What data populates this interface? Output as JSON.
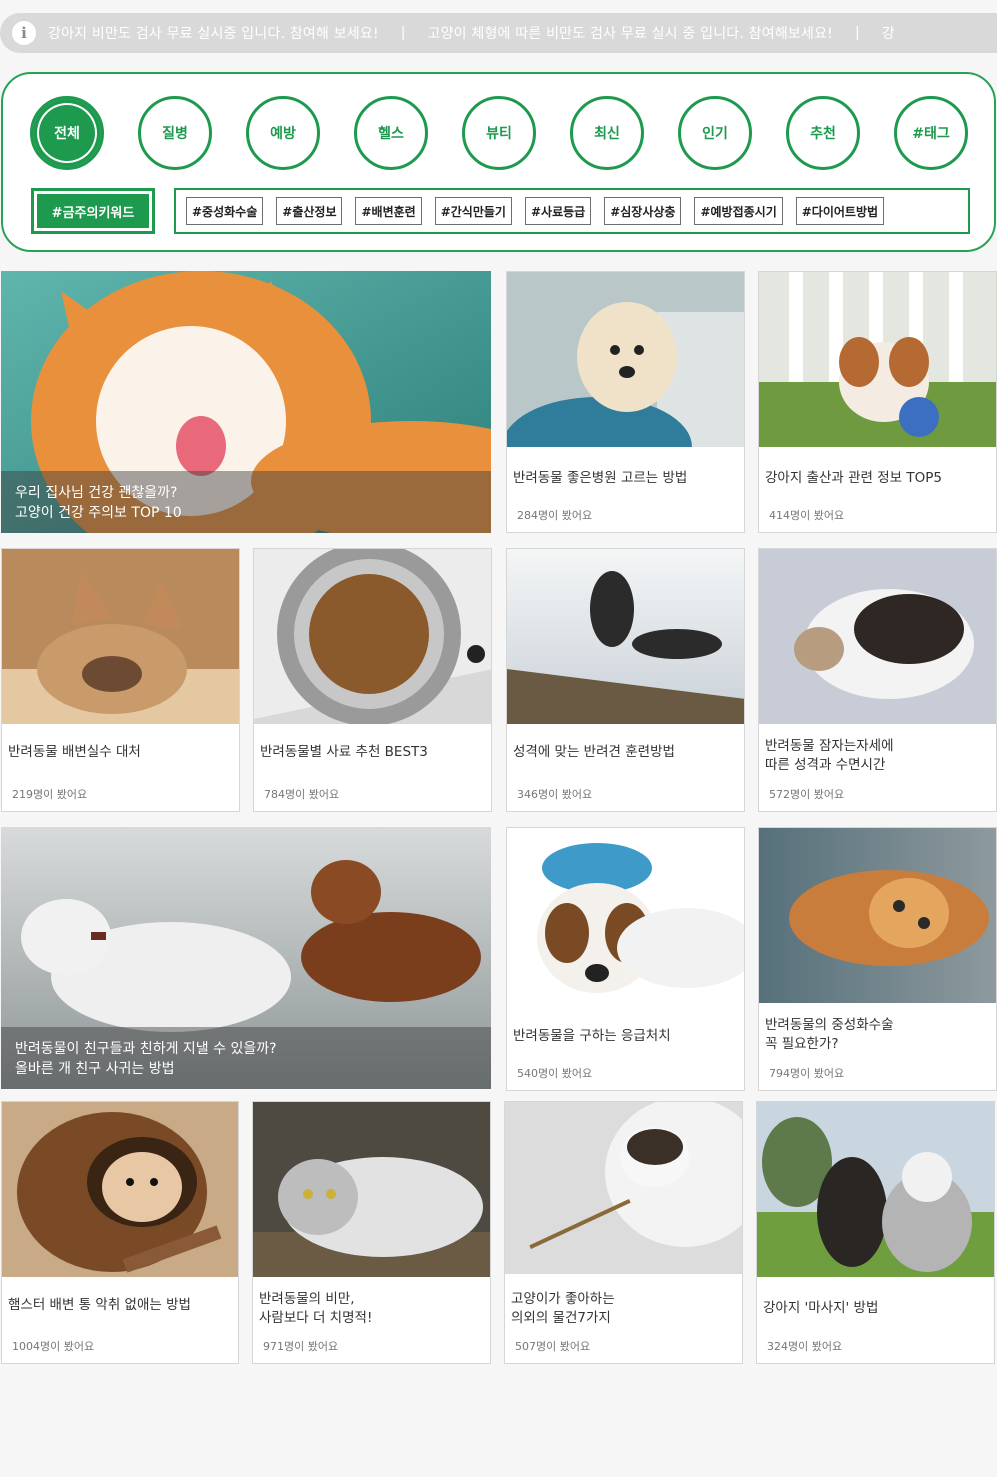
{
  "ticker": {
    "icon": "info-icon",
    "messages": [
      "강아지 비만도 검사 무료 실시중 입니다. 참여해 보세요!",
      "고양이 체형에 따른 비만도 검사 무료 실시 중 입니다.  참여해보세요!",
      "강"
    ],
    "separator": "|"
  },
  "categories": [
    {
      "label": "전체",
      "active": true
    },
    {
      "label": "질병"
    },
    {
      "label": "예방"
    },
    {
      "label": "헬스"
    },
    {
      "label": "뷰티"
    },
    {
      "label": "최신"
    },
    {
      "label": "인기"
    },
    {
      "label": "추천"
    },
    {
      "label": "#태그"
    }
  ],
  "warning_keyword_label": "#금주의키워드",
  "tags": [
    "#중성화수술",
    "#출산정보",
    "#배변훈련",
    "#간식만들기",
    "#사료등급",
    "#심장사상충",
    "#예방접종시기",
    "#다이어트방법"
  ],
  "cards": {
    "c1": {
      "title": "우리 집사님 건강 괜찮을까?\n  고양이 건강 주의보 TOP 10"
    },
    "c2": {
      "title": "반려동물 좋은병원 고르는 방법",
      "views": "284명이 봤어요"
    },
    "c3": {
      "title": "강아지 출산과 관련 정보 TOP5",
      "views": "414명이 봤어요"
    },
    "c4": {
      "title": "반려동물 배변실수 대처",
      "views": "219명이 봤어요"
    },
    "c5": {
      "title": "반려동물별 사료 추천 BEST3",
      "views": "784명이 봤어요"
    },
    "c6": {
      "title": "성격에 맞는 반려견 훈련방법",
      "views": "346명이 봤어요"
    },
    "c7": {
      "title": "반려동물 잠자는자세에\n따른 성격과 수면시간",
      "views": "572명이 봤어요"
    },
    "c8": {
      "title": "반려동물이 친구들과 친하게 지낼 수 있을까?\n올바른 개 친구 사귀는 방법"
    },
    "c9": {
      "title": "반려동물을 구하는 응급처치",
      "views": "540명이 봤어요"
    },
    "c10": {
      "title": "반려동물의 중성화수술\n꼭 필요한가?",
      "views": "794명이 봤어요"
    },
    "c11": {
      "title": "햄스터 배변 통 악취 없애는 방법",
      "views": "1004명이 봤어요"
    },
    "c12": {
      "title": "반려동물의 비만,\n사람보다 더 치명적!",
      "views": "971명이 봤어요"
    },
    "c13": {
      "title": "고양이가 좋아하는\n의외의 물건7가지",
      "views": "507명이 봤어요"
    },
    "c14": {
      "title": "강아지 '마사지' 방법",
      "views": "324명이 봤어요"
    }
  },
  "colors": {
    "accent": "#1e9a4f",
    "ticker_bg": "#d9d9d9"
  }
}
